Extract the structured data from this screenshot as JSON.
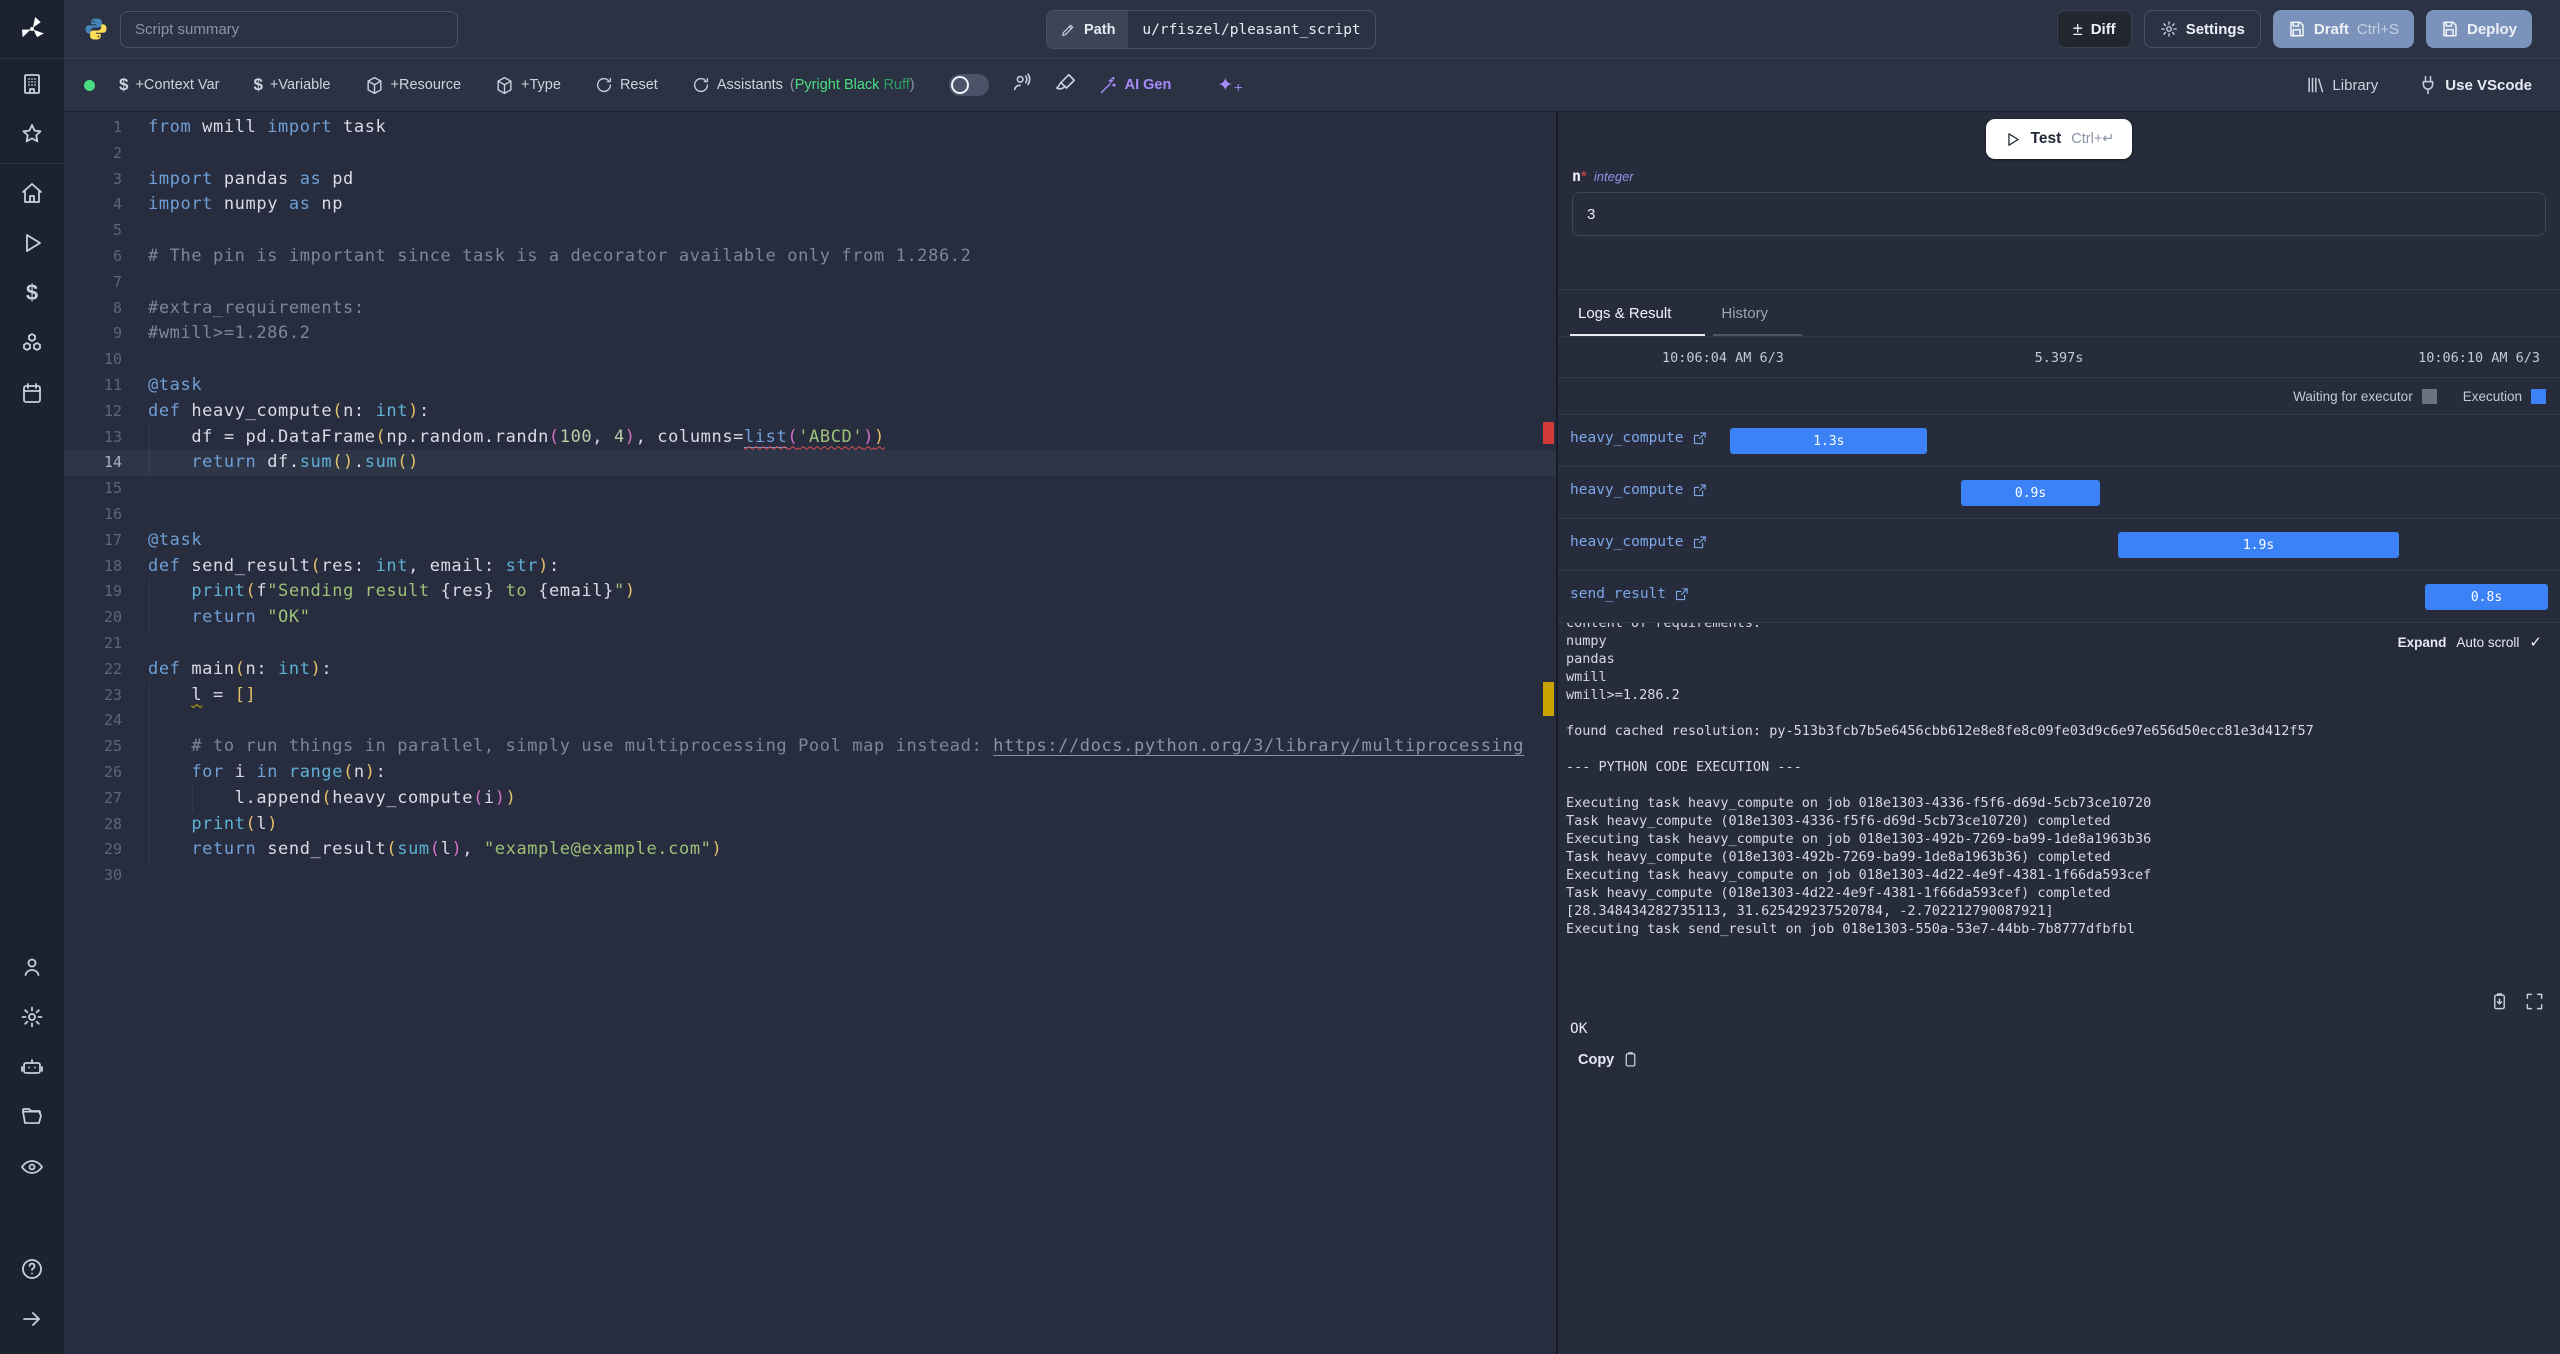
{
  "topbar": {
    "summary_placeholder": "Script summary",
    "path_label": "Path",
    "path_value": "u/rfiszel/pleasant_script",
    "diff": "Diff",
    "settings": "Settings",
    "draft": "Draft",
    "draft_kbd": "Ctrl+S",
    "deploy": "Deploy"
  },
  "toolbar": {
    "context_var": "+Context Var",
    "variable": "+Variable",
    "resource": "+Resource",
    "type": "+Type",
    "reset": "Reset",
    "assistants": "Assistants",
    "assist_open": "(",
    "assist_1": "Pyright",
    "assist_2": "Black",
    "assist_3": "Ruff",
    "assist_close": ")",
    "ai_gen": "AI Gen",
    "sparkles": "✦₊",
    "library": "Library",
    "use_vscode": "Use VScode"
  },
  "editor": {
    "active_line": 14,
    "lines": [
      {
        "g": 0,
        "s": [
          [
            "k",
            "from"
          ],
          [
            "t",
            " wmill "
          ],
          [
            "k",
            "import"
          ],
          [
            "t",
            " task"
          ]
        ]
      },
      {
        "g": 0,
        "s": []
      },
      {
        "g": 0,
        "s": [
          [
            "k",
            "import"
          ],
          [
            "t",
            " pandas "
          ],
          [
            "k",
            "as"
          ],
          [
            "t",
            " pd"
          ]
        ]
      },
      {
        "g": 0,
        "s": [
          [
            "k",
            "import"
          ],
          [
            "t",
            " numpy "
          ],
          [
            "k",
            "as"
          ],
          [
            "t",
            " np"
          ]
        ]
      },
      {
        "g": 0,
        "s": []
      },
      {
        "g": 0,
        "s": [
          [
            "c",
            "# The pin is important since task is a decorator available only from 1.286.2"
          ]
        ]
      },
      {
        "g": 0,
        "s": []
      },
      {
        "g": 0,
        "s": [
          [
            "c",
            "#extra_requirements:"
          ]
        ]
      },
      {
        "g": 0,
        "s": [
          [
            "c",
            "#wmill>=1.286.2"
          ]
        ]
      },
      {
        "g": 0,
        "s": []
      },
      {
        "g": 0,
        "s": [
          [
            "d",
            "@task"
          ]
        ]
      },
      {
        "g": 0,
        "s": [
          [
            "k",
            "def"
          ],
          [
            "t",
            " heavy_compute"
          ],
          [
            "y",
            "("
          ],
          [
            "t",
            "n: "
          ],
          [
            "b",
            "int"
          ],
          [
            "y",
            ")"
          ],
          [
            "t",
            ":"
          ]
        ]
      },
      {
        "g": 1,
        "s": [
          [
            "t",
            "    df = pd.DataFrame"
          ],
          [
            "y",
            "("
          ],
          [
            "t",
            "np.random.randn"
          ],
          [
            "m",
            "("
          ],
          [
            "n",
            "100"
          ],
          [
            "t",
            ", "
          ],
          [
            "n",
            "4"
          ],
          [
            "m",
            ")"
          ],
          [
            "t",
            ", columns="
          ],
          [
            "lk sq-r",
            "list"
          ],
          [
            "m sq-r",
            "("
          ],
          [
            "s sq-r",
            "'ABCD'"
          ],
          [
            "m sq-r",
            ")"
          ],
          [
            "y sq-r",
            ")"
          ]
        ]
      },
      {
        "g": 1,
        "s": [
          [
            "t",
            "    "
          ],
          [
            "k",
            "return"
          ],
          [
            "t",
            " df."
          ],
          [
            "b",
            "sum"
          ],
          [
            "y",
            "()"
          ],
          [
            "t",
            "."
          ],
          [
            "b",
            "sum"
          ],
          [
            "y",
            "()"
          ]
        ]
      },
      {
        "g": 0,
        "s": []
      },
      {
        "g": 0,
        "s": []
      },
      {
        "g": 0,
        "s": [
          [
            "d",
            "@task"
          ]
        ]
      },
      {
        "g": 0,
        "s": [
          [
            "k",
            "def"
          ],
          [
            "t",
            " send_result"
          ],
          [
            "y",
            "("
          ],
          [
            "t",
            "res: "
          ],
          [
            "b",
            "int"
          ],
          [
            "t",
            ", email: "
          ],
          [
            "b",
            "str"
          ],
          [
            "y",
            ")"
          ],
          [
            "t",
            ":"
          ]
        ]
      },
      {
        "g": 1,
        "s": [
          [
            "t",
            "    "
          ],
          [
            "b",
            "print"
          ],
          [
            "y",
            "("
          ],
          [
            "t",
            "f"
          ],
          [
            "s",
            "\"Sending result "
          ],
          [
            "t",
            "{res}"
          ],
          [
            "s",
            " to "
          ],
          [
            "t",
            "{email}"
          ],
          [
            "s",
            "\""
          ],
          [
            "y",
            ")"
          ]
        ]
      },
      {
        "g": 1,
        "s": [
          [
            "t",
            "    "
          ],
          [
            "k",
            "return"
          ],
          [
            "t",
            " "
          ],
          [
            "s",
            "\"OK\""
          ]
        ]
      },
      {
        "g": 0,
        "s": []
      },
      {
        "g": 0,
        "s": [
          [
            "k",
            "def"
          ],
          [
            "t",
            " main"
          ],
          [
            "y",
            "("
          ],
          [
            "t",
            "n: "
          ],
          [
            "b",
            "int"
          ],
          [
            "y",
            ")"
          ],
          [
            "t",
            ":"
          ]
        ]
      },
      {
        "g": 1,
        "s": [
          [
            "t",
            "    "
          ],
          [
            "t sq-y",
            "l"
          ],
          [
            "t",
            " = "
          ],
          [
            "y",
            "[]"
          ]
        ]
      },
      {
        "g": 1,
        "s": []
      },
      {
        "g": 1,
        "s": [
          [
            "t",
            "    "
          ],
          [
            "c",
            "# to run things in parallel, simply use multiprocessing Pool map instead: "
          ],
          [
            "u",
            "https://docs.python.org/3/library/multiprocessing"
          ]
        ]
      },
      {
        "g": 1,
        "s": [
          [
            "t",
            "    "
          ],
          [
            "k",
            "for"
          ],
          [
            "t",
            " i "
          ],
          [
            "k",
            "in"
          ],
          [
            "t",
            " "
          ],
          [
            "b",
            "range"
          ],
          [
            "y",
            "("
          ],
          [
            "t",
            "n"
          ],
          [
            "y",
            ")"
          ],
          [
            "t",
            ":"
          ]
        ]
      },
      {
        "g": 2,
        "s": [
          [
            "t",
            "        l.append"
          ],
          [
            "y",
            "("
          ],
          [
            "t",
            "heavy_compute"
          ],
          [
            "m",
            "("
          ],
          [
            "t",
            "i"
          ],
          [
            "m",
            ")"
          ],
          [
            "y",
            ")"
          ]
        ]
      },
      {
        "g": 1,
        "s": [
          [
            "t",
            "    "
          ],
          [
            "b",
            "print"
          ],
          [
            "y",
            "("
          ],
          [
            "t",
            "l"
          ],
          [
            "y",
            ")"
          ]
        ]
      },
      {
        "g": 1,
        "s": [
          [
            "t",
            "    "
          ],
          [
            "k",
            "return"
          ],
          [
            "t",
            " send_result"
          ],
          [
            "y",
            "("
          ],
          [
            "b",
            "sum"
          ],
          [
            "m",
            "("
          ],
          [
            "t",
            "l"
          ],
          [
            "m",
            ")"
          ],
          [
            "t",
            ", "
          ],
          [
            "s",
            "\"example@example.com\""
          ],
          [
            "y",
            ")"
          ]
        ]
      },
      {
        "g": 0,
        "s": []
      }
    ]
  },
  "panel": {
    "test_label": "Test",
    "test_kbd": "Ctrl+↵",
    "arg": {
      "name": "n",
      "required": "*",
      "type": "integer",
      "value": "3"
    },
    "tabs": {
      "active": "Logs & Result",
      "inactive": "History"
    },
    "times": {
      "start": "10:06:04 AM 6/3",
      "duration": "5.397s",
      "end": "10:06:10 AM 6/3"
    },
    "legend": {
      "waiting": "Waiting for executor",
      "execution": "Execution"
    },
    "timeline": {
      "rows": [
        {
          "label": "heavy_compute",
          "duration": "1.3s",
          "left_pct": 0.3,
          "width_pct": 24.0
        },
        {
          "label": "heavy_compute",
          "duration": "0.9s",
          "left_pct": 28.4,
          "width_pct": 17.0
        },
        {
          "label": "heavy_compute",
          "duration": "1.9s",
          "left_pct": 47.6,
          "width_pct": 34.2
        },
        {
          "label": "send_result",
          "duration": "0.8s",
          "left_pct": 85.0,
          "width_pct": 15.0
        }
      ]
    },
    "logs": {
      "expand": "Expand",
      "autoscroll": "Auto scroll",
      "check": "✓",
      "text": "content of requirements:\nnumpy\npandas\nwmill\nwmill>=1.286.2\n\nfound cached resolution: py-513b3fcb7b5e6456cbb612e8e8fe8c09fe03d9c6e97e656d50ecc81e3d412f57\n\n--- PYTHON CODE EXECUTION ---\n\nExecuting task heavy_compute on job 018e1303-4336-f5f6-d69d-5cb73ce10720\nTask heavy_compute (018e1303-4336-f5f6-d69d-5cb73ce10720) completed\nExecuting task heavy_compute on job 018e1303-492b-7269-ba99-1de8a1963b36\nTask heavy_compute (018e1303-492b-7269-ba99-1de8a1963b36) completed\nExecuting task heavy_compute on job 018e1303-4d22-4e9f-4381-1f66da593cef\nTask heavy_compute (018e1303-4d22-4e9f-4381-1f66da593cef) completed\n[28.348434282735113, 31.625429237520784, -2.702212790087921]\nExecuting task send_result on job 018e1303-550a-53e7-44bb-7b8777dfbfbl"
    },
    "result": {
      "value": "OK",
      "copy": "Copy"
    }
  },
  "colors": {
    "execution_blue": "#3b82f6",
    "waiting_gray": "#6b7280",
    "accent_green": "#4ade80",
    "error_red": "#d13a3a",
    "warning_yellow": "#c9a400"
  }
}
